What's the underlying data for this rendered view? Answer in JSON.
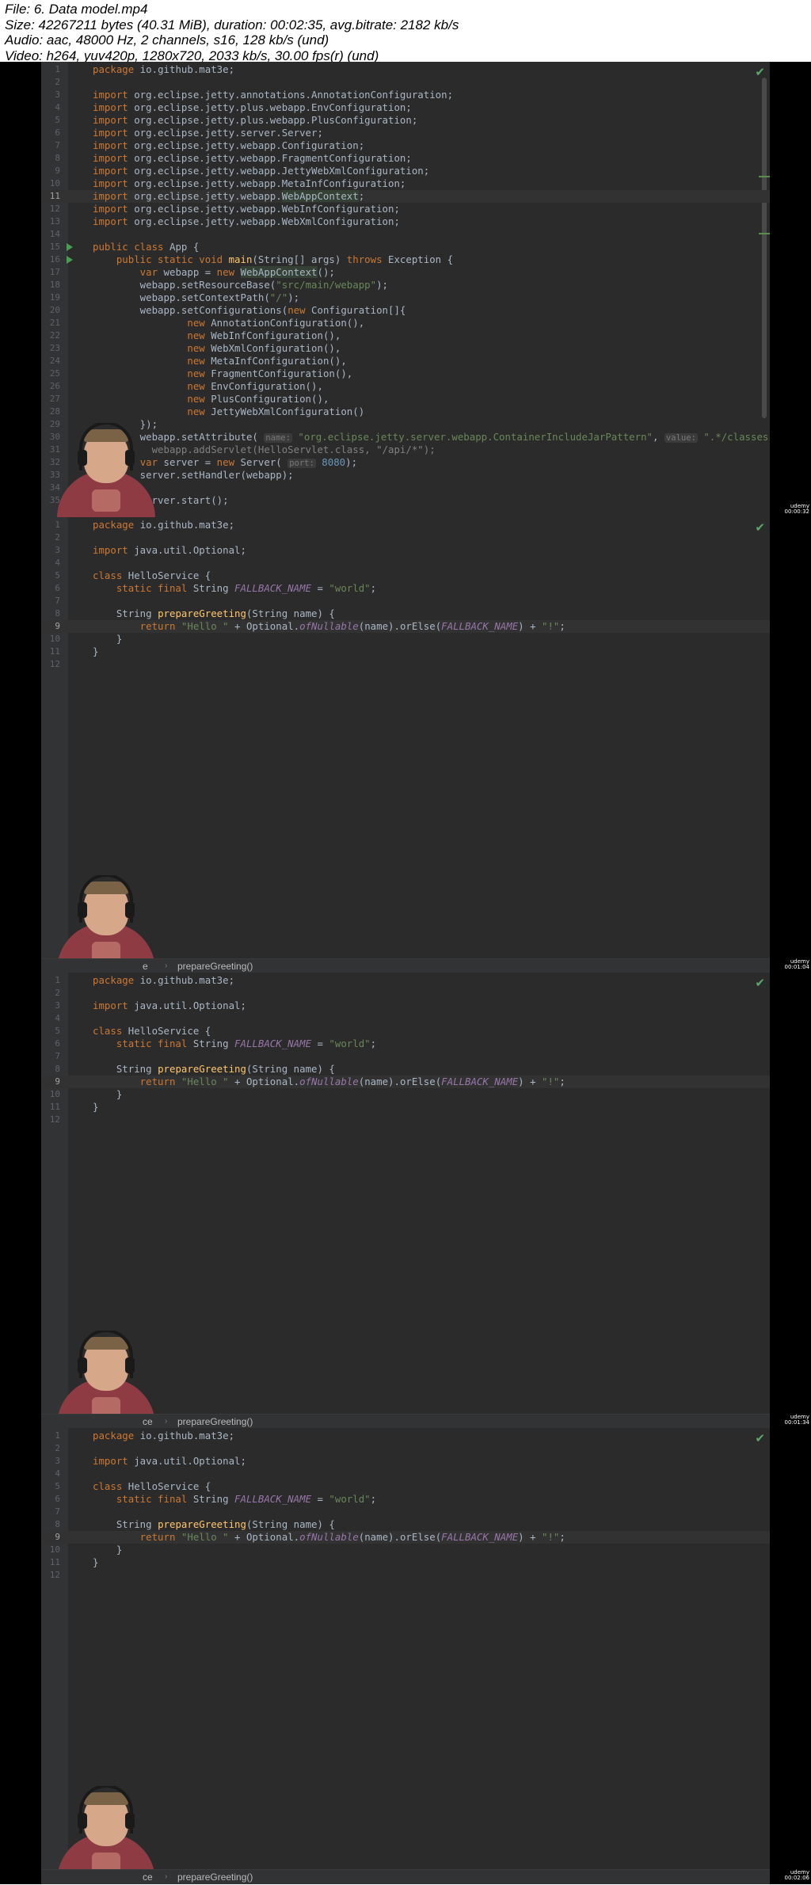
{
  "header": {
    "line1": "File: 6. Data model.mp4",
    "line2": "Size: 42267211 bytes (40.31 MiB), duration: 00:02:35, avg.bitrate: 2182 kb/s",
    "line3": "Audio: aac, 48000 Hz, 2 channels, s16, 128 kb/s (und)",
    "line4": "Video: h264, yuv420p, 1280x720, 2033 kb/s, 30.00 fps(r) (und)"
  },
  "frames": [
    {
      "breadcrumb_partial": "",
      "breadcrumb_method": "",
      "timestamp": "00:00:32"
    },
    {
      "breadcrumb_partial": "e",
      "breadcrumb_method": "prepareGreeting()",
      "timestamp": "00:01:04"
    },
    {
      "breadcrumb_partial": "ce",
      "breadcrumb_method": "prepareGreeting()",
      "timestamp": "00:01:34"
    },
    {
      "breadcrumb_partial": "ce",
      "breadcrumb_method": "prepareGreeting()",
      "timestamp": "00:02:06"
    }
  ],
  "app_code": {
    "l1": [
      "package ",
      "io.github.mat3e;"
    ],
    "l3": [
      "import ",
      "org.eclipse.jetty.annotations.AnnotationConfiguration;"
    ],
    "l4": [
      "import ",
      "org.eclipse.jetty.plus.webapp.EnvConfiguration;"
    ],
    "l5": [
      "import ",
      "org.eclipse.jetty.plus.webapp.PlusConfiguration;"
    ],
    "l6": [
      "import ",
      "org.eclipse.jetty.server.Server;"
    ],
    "l7": [
      "import ",
      "org.eclipse.jetty.webapp.Configuration;"
    ],
    "l8": [
      "import ",
      "org.eclipse.jetty.webapp.FragmentConfiguration;"
    ],
    "l9": [
      "import ",
      "org.eclipse.jetty.webapp.JettyWebXmlConfiguration;"
    ],
    "l10": [
      "import ",
      "org.eclipse.jetty.webapp.MetaInfConfiguration;"
    ],
    "l11": [
      "import ",
      "org.eclipse.jetty.webapp.",
      "WebAppContext",
      ";"
    ],
    "l12": [
      "import ",
      "org.eclipse.jetty.webapp.WebInfConfiguration;"
    ],
    "l13": [
      "import ",
      "org.eclipse.jetty.webapp.WebXmlConfiguration;"
    ],
    "l15": [
      "public class ",
      "App {"
    ],
    "l16": [
      "    public static void ",
      "main",
      "(String[] args) ",
      "throws ",
      "Exception {"
    ],
    "l17": [
      "        var ",
      "webapp = ",
      "new ",
      "WebAppContext",
      "();"
    ],
    "l18": [
      "        webapp.setResourceBase(",
      "\"src/main/webapp\"",
      ");"
    ],
    "l19": [
      "        webapp.setContextPath(",
      "\"/\"",
      ");"
    ],
    "l20": [
      "        webapp.setConfigurations(",
      "new ",
      "Configuration[]{"
    ],
    "l21": [
      "                ",
      "new ",
      "AnnotationConfiguration(),"
    ],
    "l22": [
      "                ",
      "new ",
      "WebInfConfiguration(),"
    ],
    "l23": [
      "                ",
      "new ",
      "WebXmlConfiguration(),"
    ],
    "l24": [
      "                ",
      "new ",
      "MetaInfConfiguration(),"
    ],
    "l25": [
      "                ",
      "new ",
      "FragmentConfiguration(),"
    ],
    "l26": [
      "                ",
      "new ",
      "EnvConfiguration(),"
    ],
    "l27": [
      "                ",
      "new ",
      "PlusConfiguration(),"
    ],
    "l28": [
      "                ",
      "new ",
      "JettyWebXmlConfiguration()"
    ],
    "l29": [
      "        });"
    ],
    "l30": [
      "        webapp.setAttribute( ",
      "name:",
      " \"org.eclipse.jetty.server.webapp.ContainerIncludeJarPattern\"",
      ", ",
      "value:",
      " \".*/classes"
    ],
    "l31": [
      "          webapp.addServlet(HelloServlet.class, \"/api/*\");"
    ],
    "l32": [
      "        ",
      "var ",
      "server = ",
      "new ",
      "Server( ",
      "port:",
      " ",
      "8080",
      ");"
    ],
    "l33": [
      "        server.setHandler(webapp);"
    ],
    "l35": [
      "        server.start();"
    ]
  },
  "hello_code": {
    "l1": [
      "package ",
      "io.github.mat3e;"
    ],
    "l3": [
      "import ",
      "java.util.Optional;"
    ],
    "l5": [
      "class ",
      "HelloService {"
    ],
    "l6": [
      "    static final ",
      "String ",
      "FALLBACK_NAME",
      " = ",
      "\"world\"",
      ";"
    ],
    "l8": [
      "    String ",
      "prepareGreeting",
      "(String name) {"
    ],
    "l9": [
      "        return ",
      "\"Hello \"",
      " + Optional.",
      "ofNullable",
      "(name).orElse(",
      "FALLBACK_NAME",
      ") + ",
      "\"!\"",
      ";"
    ],
    "l10": [
      "    }"
    ],
    "l11": [
      "}"
    ]
  }
}
